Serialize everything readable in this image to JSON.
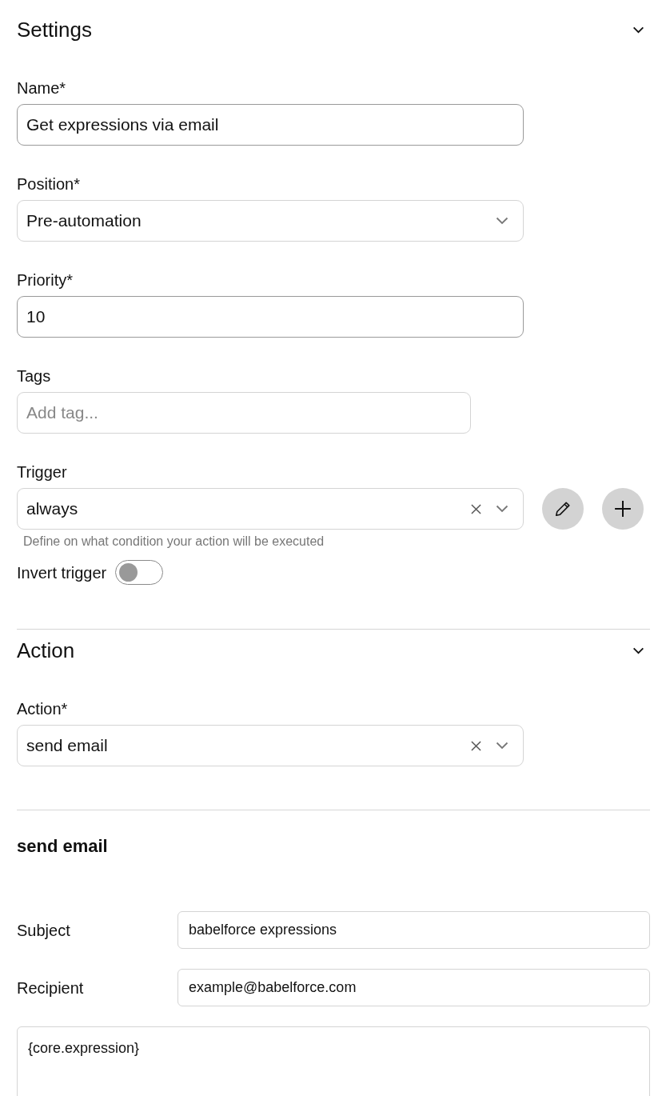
{
  "settings": {
    "title": "Settings",
    "expanded": true,
    "fields": [
      {
        "kind": "text",
        "label": "Name*",
        "value": "Get expressions via email"
      },
      {
        "kind": "select",
        "label": "Position*",
        "value": "Pre-automation",
        "clearable": false
      },
      {
        "kind": "text",
        "label": "Priority*",
        "value": "10"
      },
      {
        "kind": "tags",
        "label": "Tags",
        "placeholder": "Add tag..."
      }
    ],
    "trigger": {
      "label": "Trigger",
      "value": "always",
      "clearable": true,
      "hint": "Define on what condition your action will be executed"
    },
    "invert_trigger": {
      "label": "Invert trigger",
      "on": false
    }
  },
  "action": {
    "title": "Action",
    "expanded": true,
    "fields": [
      {
        "kind": "select",
        "label": "Action*",
        "value": "send email",
        "clearable": true
      }
    ]
  },
  "action_details": {
    "title": "send email",
    "fields": [
      {
        "label": "Subject",
        "value": "babelforce expressions"
      },
      {
        "label": "Recipient",
        "value": "example@babelforce.com"
      }
    ],
    "body": "{core.expression}"
  }
}
